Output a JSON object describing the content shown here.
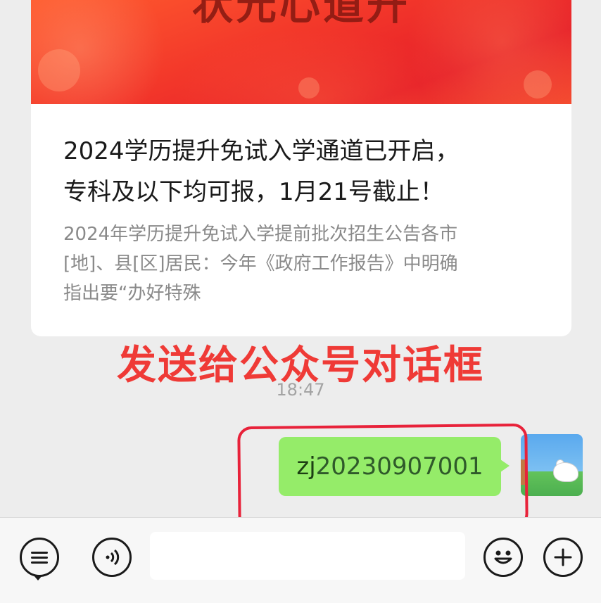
{
  "article_card": {
    "banner_title": "状元心道升",
    "title_line1": "2024学历提升免试入学通道已开启，",
    "title_line2": "专科及以下均可报，1月21号截止！",
    "description_line1": "2024年学历提升免试入学提前批次招生公告各市",
    "description_line2": "[地]、县[区]居民：今年《政府工作报告》中明确",
    "description_line3": "指出要“办好特殊"
  },
  "annotation": {
    "caption": "发送给公众号对话框",
    "highlight_color": "#e8223a"
  },
  "chat": {
    "timestamp": "18:47",
    "message_prefix": "zj",
    "message_code": "20230907001",
    "bubble_color": "#95ec69"
  },
  "input_bar": {
    "menu_icon": "list-menu-icon",
    "voice_icon": "voice-icon",
    "emoji_icon": "emoji-icon",
    "plus_icon": "plus-icon"
  }
}
